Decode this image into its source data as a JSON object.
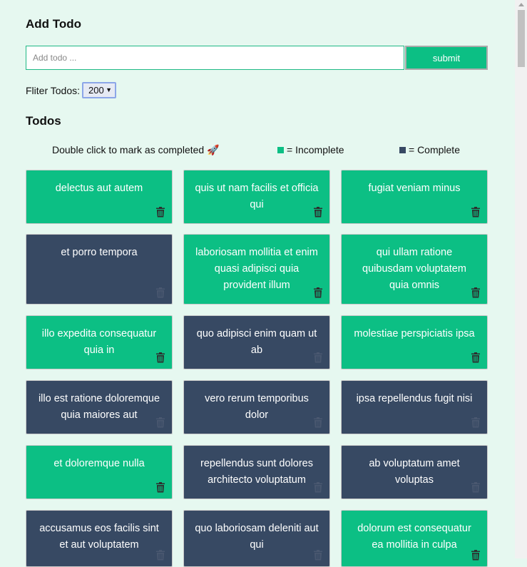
{
  "add": {
    "title": "Add Todo",
    "placeholder": "Add todo ...",
    "submit_label": "submit"
  },
  "filter": {
    "label": "Fliter Todos:",
    "selected": "200"
  },
  "todos": {
    "title": "Todos",
    "hint": "Double click to mark as completed 🚀",
    "legend_incomplete": "= Incomplete",
    "legend_complete": "= Complete",
    "colors": {
      "incomplete": "#0cbf84",
      "complete": "#374963"
    },
    "items": [
      {
        "title": "delectus aut autem",
        "completed": false
      },
      {
        "title": "quis ut nam facilis et officia qui",
        "completed": false
      },
      {
        "title": "fugiat veniam minus",
        "completed": false
      },
      {
        "title": "et porro tempora",
        "completed": true
      },
      {
        "title": "laboriosam mollitia et enim quasi adipisci quia provident illum",
        "completed": false
      },
      {
        "title": "qui ullam ratione quibusdam voluptatem quia omnis",
        "completed": false
      },
      {
        "title": "illo expedita consequatur quia in",
        "completed": false
      },
      {
        "title": "quo adipisci enim quam ut ab",
        "completed": true
      },
      {
        "title": "molestiae perspiciatis ipsa",
        "completed": false
      },
      {
        "title": "illo est ratione doloremque quia maiores aut",
        "completed": true
      },
      {
        "title": "vero rerum temporibus dolor",
        "completed": true
      },
      {
        "title": "ipsa repellendus fugit nisi",
        "completed": true
      },
      {
        "title": "et doloremque nulla",
        "completed": false
      },
      {
        "title": "repellendus sunt dolores architecto voluptatum",
        "completed": true
      },
      {
        "title": "ab voluptatum amet voluptas",
        "completed": true
      },
      {
        "title": "accusamus eos facilis sint et aut voluptatem",
        "completed": true
      },
      {
        "title": "quo laboriosam deleniti aut qui",
        "completed": true
      },
      {
        "title": "dolorum est consequatur ea mollitia in culpa",
        "completed": false
      }
    ]
  }
}
